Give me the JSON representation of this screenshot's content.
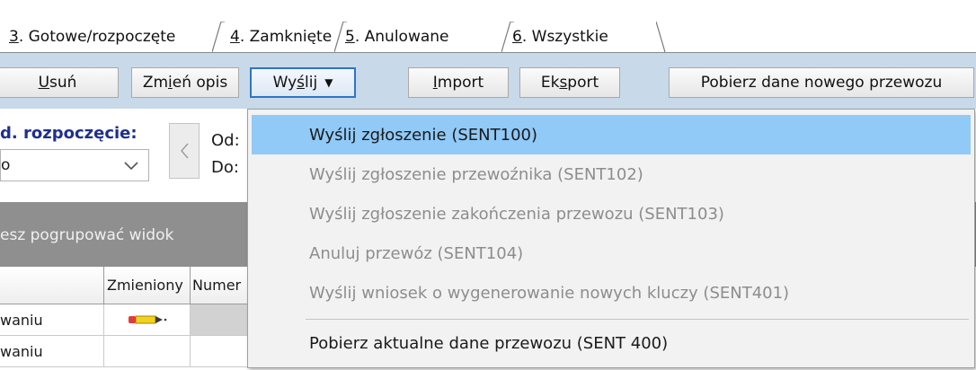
{
  "tabs": [
    {
      "prefix": "3",
      "label": ". Gotowe/rozpoczęte"
    },
    {
      "prefix": "4",
      "label": ". Zamknięte"
    },
    {
      "prefix": "5",
      "label": ". Anulowane"
    },
    {
      "prefix": "6",
      "label": ". Wszystkie"
    }
  ],
  "toolbar": {
    "delete": {
      "a": "",
      "u": "U",
      "b": "suń"
    },
    "change_desc": {
      "a": "Zm",
      "u": "i",
      "b": "eń opis"
    },
    "send": {
      "a": "Wy",
      "u": "ś",
      "b": "lij"
    },
    "import": {
      "a": "",
      "u": "I",
      "b": "mport"
    },
    "export": {
      "a": "Ek",
      "u": "s",
      "b": "port"
    },
    "fetch_new": "Pobierz dane nowego przewozu"
  },
  "filter": {
    "label_start": "d. rozpoczęcie:",
    "combo_value": "o",
    "from_label": "Od:",
    "to_label": "Do:"
  },
  "group_hint": "esz pogrupować widok",
  "grid": {
    "columns": [
      "",
      "Zmieniony",
      "Numer"
    ],
    "rows": [
      {
        "status": "waniu",
        "changed_icon": "pencil-icon"
      },
      {
        "status": "waniu",
        "changed_icon": ""
      }
    ]
  },
  "menu": {
    "items": [
      {
        "label": "Wyślij zgłoszenie (SENT100)",
        "enabled": true,
        "highlighted": true
      },
      {
        "label": "Wyślij zgłoszenie przewoźnika (SENT102)",
        "enabled": false
      },
      {
        "label": "Wyślij zgłoszenie zakończenia przewozu (SENT103)",
        "enabled": false
      },
      {
        "label": "Anuluj przewóz (SENT104)",
        "enabled": false
      },
      {
        "label": "Wyślij wniosek o wygenerowanie nowych kluczy (SENT401)",
        "enabled": false
      },
      {
        "label": "Pobierz aktualne dane przewozu (SENT 400)",
        "enabled": true
      }
    ]
  },
  "colors": {
    "toolbar_bg": "#c8d9ea",
    "menu_highlight": "#91c9f7",
    "label_blue": "#1f2f8f",
    "group_band": "#8f8f8f"
  }
}
